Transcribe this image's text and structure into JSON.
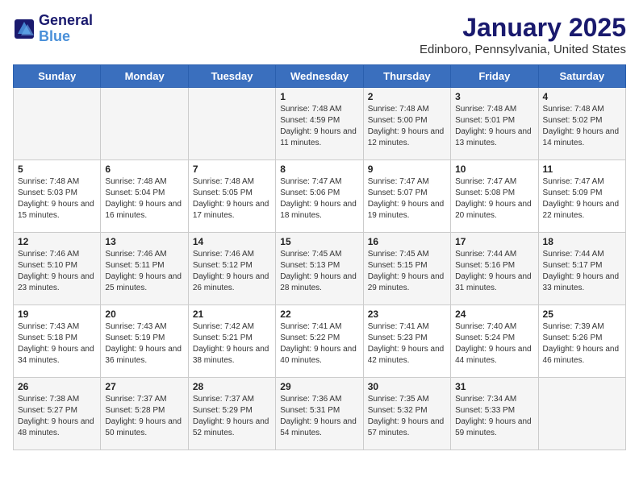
{
  "header": {
    "logo_line1": "General",
    "logo_line2": "Blue",
    "title": "January 2025",
    "subtitle": "Edinboro, Pennsylvania, United States"
  },
  "weekdays": [
    "Sunday",
    "Monday",
    "Tuesday",
    "Wednesday",
    "Thursday",
    "Friday",
    "Saturday"
  ],
  "weeks": [
    [
      {
        "day": "",
        "content": ""
      },
      {
        "day": "",
        "content": ""
      },
      {
        "day": "",
        "content": ""
      },
      {
        "day": "1",
        "content": "Sunrise: 7:48 AM\nSunset: 4:59 PM\nDaylight: 9 hours\nand 11 minutes."
      },
      {
        "day": "2",
        "content": "Sunrise: 7:48 AM\nSunset: 5:00 PM\nDaylight: 9 hours\nand 12 minutes."
      },
      {
        "day": "3",
        "content": "Sunrise: 7:48 AM\nSunset: 5:01 PM\nDaylight: 9 hours\nand 13 minutes."
      },
      {
        "day": "4",
        "content": "Sunrise: 7:48 AM\nSunset: 5:02 PM\nDaylight: 9 hours\nand 14 minutes."
      }
    ],
    [
      {
        "day": "5",
        "content": "Sunrise: 7:48 AM\nSunset: 5:03 PM\nDaylight: 9 hours\nand 15 minutes."
      },
      {
        "day": "6",
        "content": "Sunrise: 7:48 AM\nSunset: 5:04 PM\nDaylight: 9 hours\nand 16 minutes."
      },
      {
        "day": "7",
        "content": "Sunrise: 7:48 AM\nSunset: 5:05 PM\nDaylight: 9 hours\nand 17 minutes."
      },
      {
        "day": "8",
        "content": "Sunrise: 7:47 AM\nSunset: 5:06 PM\nDaylight: 9 hours\nand 18 minutes."
      },
      {
        "day": "9",
        "content": "Sunrise: 7:47 AM\nSunset: 5:07 PM\nDaylight: 9 hours\nand 19 minutes."
      },
      {
        "day": "10",
        "content": "Sunrise: 7:47 AM\nSunset: 5:08 PM\nDaylight: 9 hours\nand 20 minutes."
      },
      {
        "day": "11",
        "content": "Sunrise: 7:47 AM\nSunset: 5:09 PM\nDaylight: 9 hours\nand 22 minutes."
      }
    ],
    [
      {
        "day": "12",
        "content": "Sunrise: 7:46 AM\nSunset: 5:10 PM\nDaylight: 9 hours\nand 23 minutes."
      },
      {
        "day": "13",
        "content": "Sunrise: 7:46 AM\nSunset: 5:11 PM\nDaylight: 9 hours\nand 25 minutes."
      },
      {
        "day": "14",
        "content": "Sunrise: 7:46 AM\nSunset: 5:12 PM\nDaylight: 9 hours\nand 26 minutes."
      },
      {
        "day": "15",
        "content": "Sunrise: 7:45 AM\nSunset: 5:13 PM\nDaylight: 9 hours\nand 28 minutes."
      },
      {
        "day": "16",
        "content": "Sunrise: 7:45 AM\nSunset: 5:15 PM\nDaylight: 9 hours\nand 29 minutes."
      },
      {
        "day": "17",
        "content": "Sunrise: 7:44 AM\nSunset: 5:16 PM\nDaylight: 9 hours\nand 31 minutes."
      },
      {
        "day": "18",
        "content": "Sunrise: 7:44 AM\nSunset: 5:17 PM\nDaylight: 9 hours\nand 33 minutes."
      }
    ],
    [
      {
        "day": "19",
        "content": "Sunrise: 7:43 AM\nSunset: 5:18 PM\nDaylight: 9 hours\nand 34 minutes."
      },
      {
        "day": "20",
        "content": "Sunrise: 7:43 AM\nSunset: 5:19 PM\nDaylight: 9 hours\nand 36 minutes."
      },
      {
        "day": "21",
        "content": "Sunrise: 7:42 AM\nSunset: 5:21 PM\nDaylight: 9 hours\nand 38 minutes."
      },
      {
        "day": "22",
        "content": "Sunrise: 7:41 AM\nSunset: 5:22 PM\nDaylight: 9 hours\nand 40 minutes."
      },
      {
        "day": "23",
        "content": "Sunrise: 7:41 AM\nSunset: 5:23 PM\nDaylight: 9 hours\nand 42 minutes."
      },
      {
        "day": "24",
        "content": "Sunrise: 7:40 AM\nSunset: 5:24 PM\nDaylight: 9 hours\nand 44 minutes."
      },
      {
        "day": "25",
        "content": "Sunrise: 7:39 AM\nSunset: 5:26 PM\nDaylight: 9 hours\nand 46 minutes."
      }
    ],
    [
      {
        "day": "26",
        "content": "Sunrise: 7:38 AM\nSunset: 5:27 PM\nDaylight: 9 hours\nand 48 minutes."
      },
      {
        "day": "27",
        "content": "Sunrise: 7:37 AM\nSunset: 5:28 PM\nDaylight: 9 hours\nand 50 minutes."
      },
      {
        "day": "28",
        "content": "Sunrise: 7:37 AM\nSunset: 5:29 PM\nDaylight: 9 hours\nand 52 minutes."
      },
      {
        "day": "29",
        "content": "Sunrise: 7:36 AM\nSunset: 5:31 PM\nDaylight: 9 hours\nand 54 minutes."
      },
      {
        "day": "30",
        "content": "Sunrise: 7:35 AM\nSunset: 5:32 PM\nDaylight: 9 hours\nand 57 minutes."
      },
      {
        "day": "31",
        "content": "Sunrise: 7:34 AM\nSunset: 5:33 PM\nDaylight: 9 hours\nand 59 minutes."
      },
      {
        "day": "",
        "content": ""
      }
    ]
  ]
}
